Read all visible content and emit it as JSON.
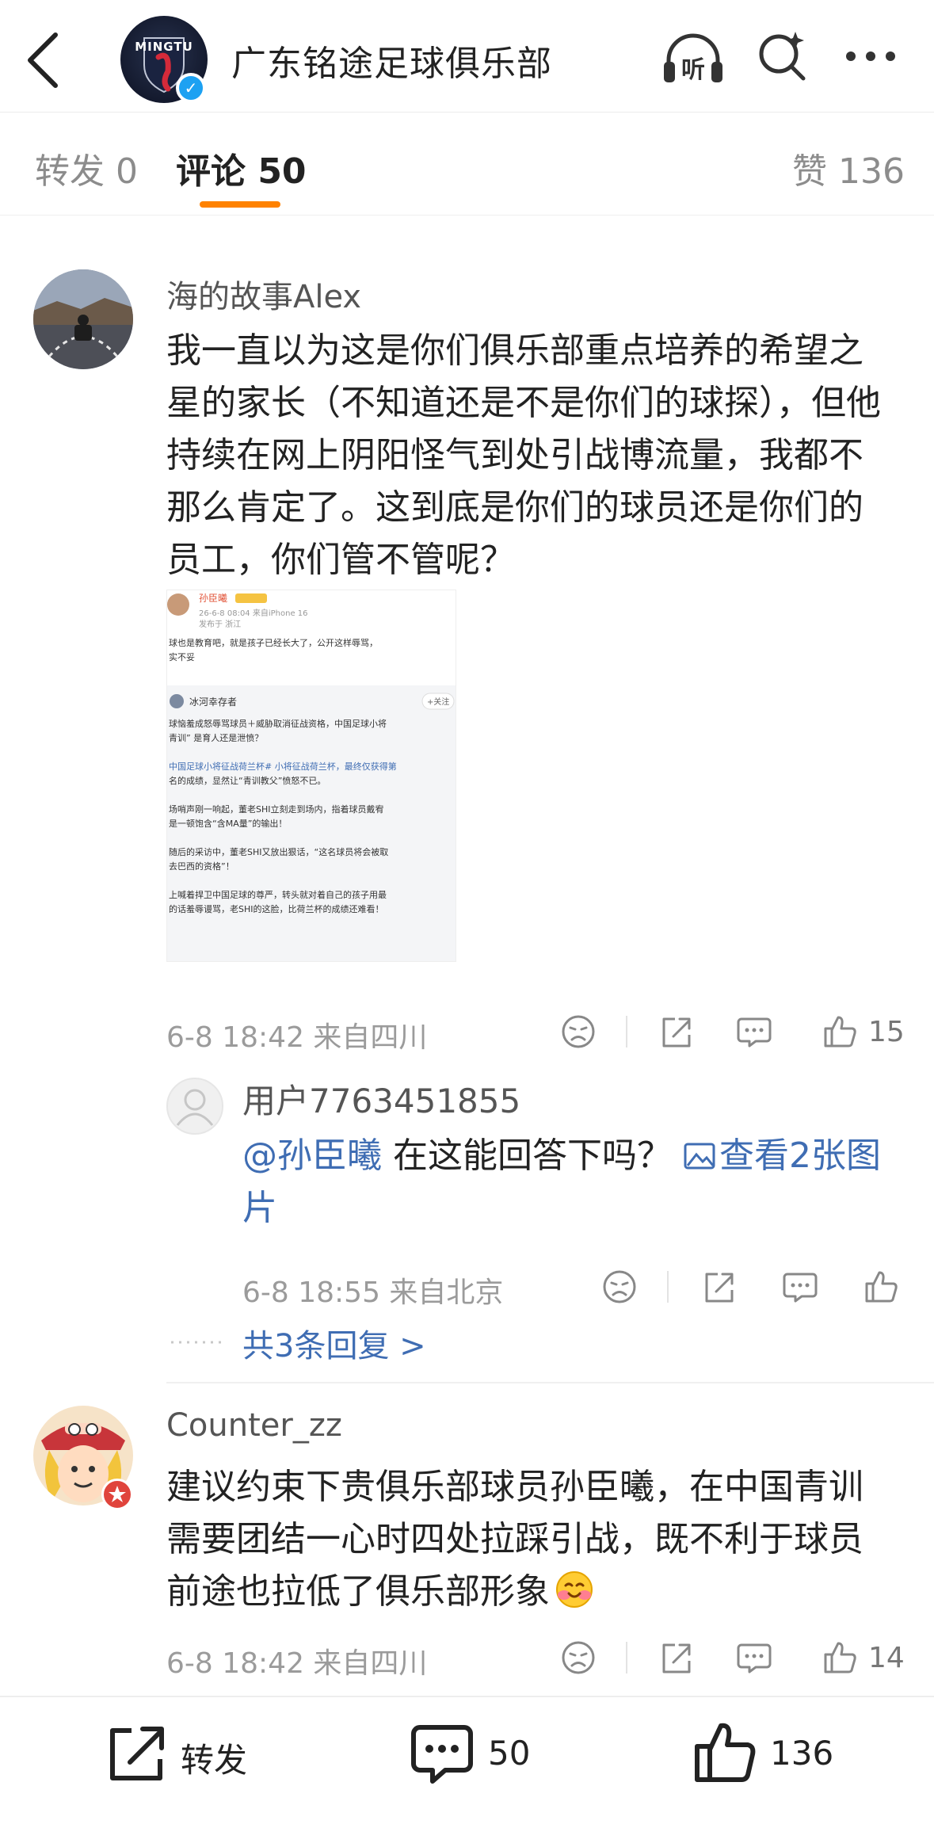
{
  "header": {
    "title": "广东铭途足球俱乐部",
    "logo_text": "MINGTU",
    "listen_label": "听"
  },
  "tabs": {
    "repost": "转发 0",
    "comments": "评论 50",
    "likes": "赞 136"
  },
  "comments": [
    {
      "user": "海的故事Alex",
      "text": "我一直以为这是你们俱乐部重点培养的希望之星的家长（不知道还是不是你们的球探），但他持续在网上阴阳怪气到处引战博流量，我都不那么肯定了。这到底是你们的球员还是你们的员工，你们管不管呢？",
      "time": "6-8 18:42 来自四川",
      "like_count": "15",
      "embedded": {
        "poster": "孙臣曦",
        "post_time": "26-6-8 08:04 来自iPhone 16",
        "location": "发布于 浙江",
        "line1": "球也是教育吧，就是孩子已经长大了，公开这样辱骂，",
        "line2": "实不妥",
        "quoted_user": "冰河幸存者",
        "follow": "+关注",
        "q1": "球恼羞成怒辱骂球员＋威胁取消征战资格，中国足球小将",
        "q2": "青训” 是育人还是泄愤？",
        "q3": "中国足球小将征战荷兰杯# 小将征战荷兰杯，最终仅获得第",
        "q4": "名的成绩，显然让“青训教父”愤怒不已。",
        "q5": "场哨声刚一响起，董老SHI立刻走到场内，指着球员戴宥",
        "q6": "是一顿饱含“含MA量”的输出！",
        "q7": "随后的采访中，董老SHI又放出狠话，“这名球员将会被取",
        "q8": "去巴西的资格”！",
        "q9": "上喊着捍卫中国足球的尊严，转头就对着自己的孩子用最",
        "q10": "的话羞辱谩骂，老SHI的这脸，比荷兰杯的成绩还难看！"
      },
      "reply": {
        "user": "用户7763451855",
        "mention": "@孙臣曦",
        "text": " 在这能回答下吗？ ",
        "image_link": "查看2张图片",
        "time": "6-8 18:55 来自北京"
      },
      "more_replies": "共3条回复 >"
    },
    {
      "user": "Counter_zz",
      "text": "建议约束下贵俱乐部球员孙臣曦，在中国青训需要团结一心时四处拉踩引战，既不利于球员前途也拉低了俱乐部形象",
      "time": "6-8 18:42 来自四川",
      "like_count": "14"
    }
  ],
  "bottom": {
    "repost": "转发",
    "comments": "50",
    "likes": "136"
  }
}
